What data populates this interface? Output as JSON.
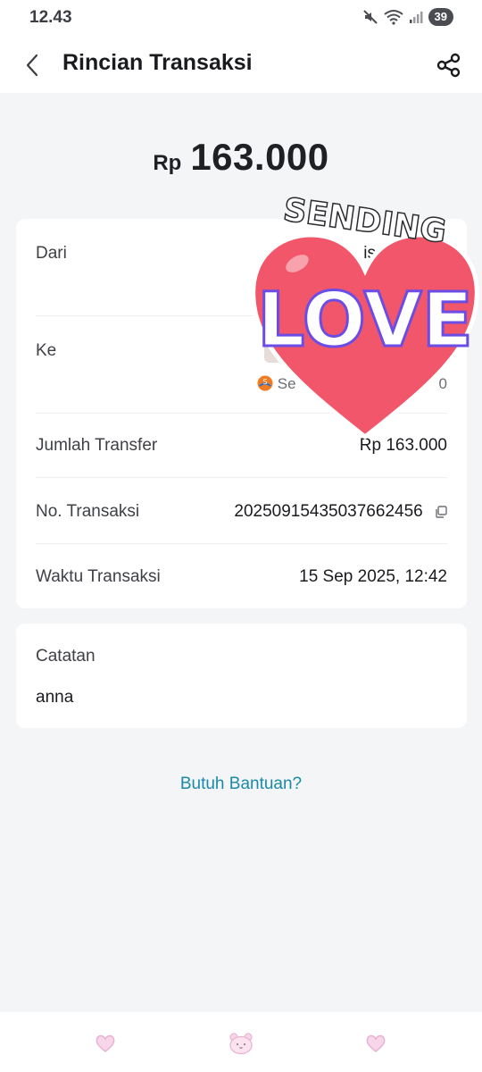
{
  "status_bar": {
    "time": "12.43",
    "battery": "39"
  },
  "header": {
    "title": "Rincian Transaksi"
  },
  "amount": {
    "currency": "Rp",
    "value": "163.000"
  },
  "details": {
    "from_label": "Dari",
    "from_value_fragment": "is",
    "to_label": "Ke",
    "to_sub_prefix": "Se",
    "to_sub_suffix": "0",
    "transfer_label": "Jumlah Transfer",
    "transfer_value": "Rp 163.000",
    "txn_no_label": "No. Transaksi",
    "txn_no_value": "20250915435037662456",
    "txn_time_label": "Waktu Transaksi",
    "txn_time_value": "15 Sep 2025, 12:42"
  },
  "notes": {
    "label": "Catatan",
    "value": "anna"
  },
  "help": {
    "label": "Butuh Bantuan?"
  },
  "sticker": {
    "top_text": "SENDING",
    "main_text": "LOVE"
  },
  "colors": {
    "link": "#1a8aa8",
    "heart": "#f2566a",
    "background": "#f4f5f7"
  },
  "icons": {
    "back": "chevron-left-icon",
    "share": "share-icon",
    "copy": "copy-icon",
    "mute": "mute-icon",
    "wifi": "wifi-icon",
    "signal": "signal-icon"
  }
}
